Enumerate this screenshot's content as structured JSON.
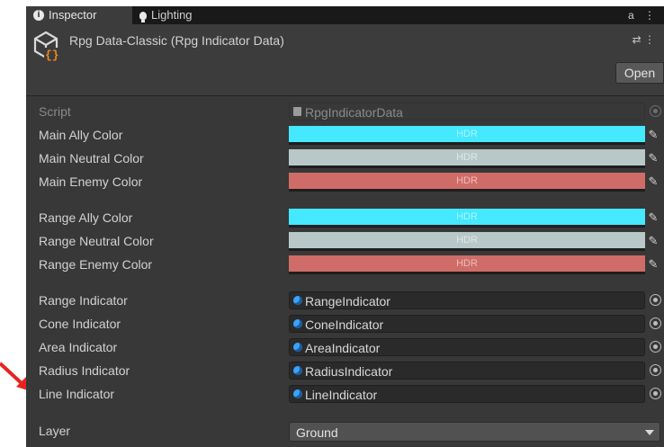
{
  "tabs": {
    "inspector": "Inspector",
    "lighting": "Lighting",
    "tools": "a ⋮"
  },
  "header": {
    "title": "Rpg Data-Classic (Rpg Indicator Data)",
    "tools": "⇄ ⋮",
    "open_label": "Open"
  },
  "script_row": {
    "label": "Script",
    "value": "RpgIndicatorData"
  },
  "colors": [
    {
      "label": "Main Ally Color",
      "hex": "#44e8ff",
      "tag": "HDR"
    },
    {
      "label": "Main Neutral Color",
      "hex": "#b8c8c9",
      "tag": "HDR"
    },
    {
      "label": "Main Enemy Color",
      "hex": "#d06c68",
      "tag": "HDR"
    },
    {
      "label": "Range Ally Color",
      "hex": "#44e8ff",
      "tag": "HDR"
    },
    {
      "label": "Range Neutral Color",
      "hex": "#b8c8c9",
      "tag": "HDR"
    },
    {
      "label": "Range Enemy Color",
      "hex": "#d06c68",
      "tag": "HDR"
    }
  ],
  "indicators": [
    {
      "label": "Range Indicator",
      "value": "RangeIndicator"
    },
    {
      "label": "Cone Indicator",
      "value": "ConeIndicator"
    },
    {
      "label": "Area Indicator",
      "value": "AreaIndicator"
    },
    {
      "label": "Radius Indicator",
      "value": "RadiusIndicator"
    },
    {
      "label": "Line Indicator",
      "value": "LineIndicator"
    }
  ],
  "layer": {
    "label": "Layer",
    "value": "Ground"
  },
  "accent": {
    "annotation_arrow": "#e8231f"
  }
}
